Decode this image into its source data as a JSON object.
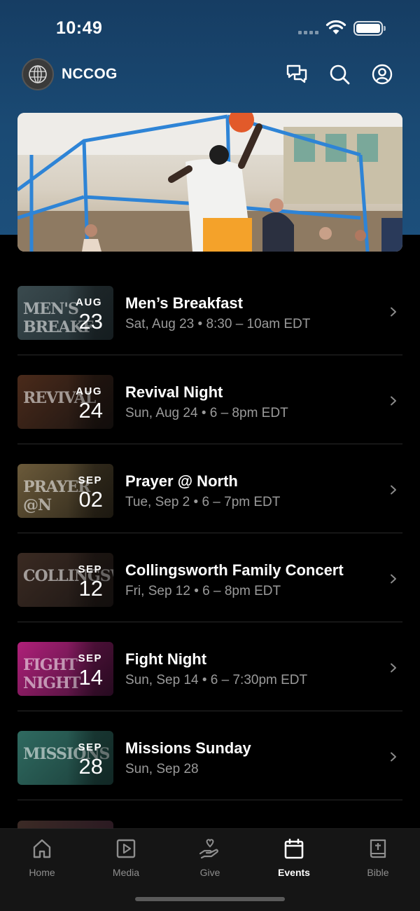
{
  "status_bar": {
    "time": "10:49"
  },
  "app_bar": {
    "org_name": "NCCOG",
    "icons": [
      "chat-icon",
      "search-icon",
      "account-icon"
    ]
  },
  "hero": {
    "image": "basketball-game-photo"
  },
  "events": [
    {
      "month": "AUG",
      "day": "23",
      "title": "Men’s Breakfast",
      "meta": "Sat, Aug 23 • 8:30 – 10am EDT",
      "thumb_art": "MEN'S BREAKF",
      "thumb_colors": [
        "#3a4a4e",
        "#202c30"
      ]
    },
    {
      "month": "AUG",
      "day": "24",
      "title": "Revival Night",
      "meta": "Sun, Aug 24 • 6 – 8pm EDT",
      "thumb_art": "REVIVAL",
      "thumb_colors": [
        "#4a2a1a",
        "#1a1412"
      ]
    },
    {
      "month": "SEP",
      "day": "02",
      "title": "Prayer @ North",
      "meta": "Tue, Sep 2 • 6 – 7pm EDT",
      "thumb_art": "PRAYER @N",
      "thumb_colors": [
        "#6b5a3a",
        "#2a2418"
      ]
    },
    {
      "month": "SEP",
      "day": "12",
      "title": "Collingsworth Family Concert",
      "meta": "Fri, Sep 12 • 6 – 8pm EDT",
      "thumb_art": "COLLINGSWORTH",
      "thumb_colors": [
        "#3a2a22",
        "#1c1614"
      ]
    },
    {
      "month": "SEP",
      "day": "14",
      "title": "Fight Night",
      "meta": "Sun, Sep 14 • 6 – 7:30pm EDT",
      "thumb_art": "FIGHT NIGHT",
      "thumb_colors": [
        "#b0207a",
        "#3a1030"
      ]
    },
    {
      "month": "SEP",
      "day": "28",
      "title": "Missions Sunday",
      "meta": "Sun, Sep 28",
      "thumb_art": "MISSIONS",
      "thumb_colors": [
        "#2f6a60",
        "#1a3c38"
      ]
    }
  ],
  "tab_bar": {
    "tabs": [
      {
        "label": "Home",
        "icon": "home-icon",
        "active": false
      },
      {
        "label": "Media",
        "icon": "media-icon",
        "active": false
      },
      {
        "label": "Give",
        "icon": "give-icon",
        "active": false
      },
      {
        "label": "Events",
        "icon": "calendar-icon",
        "active": true
      },
      {
        "label": "Bible",
        "icon": "bible-icon",
        "active": false
      }
    ]
  }
}
